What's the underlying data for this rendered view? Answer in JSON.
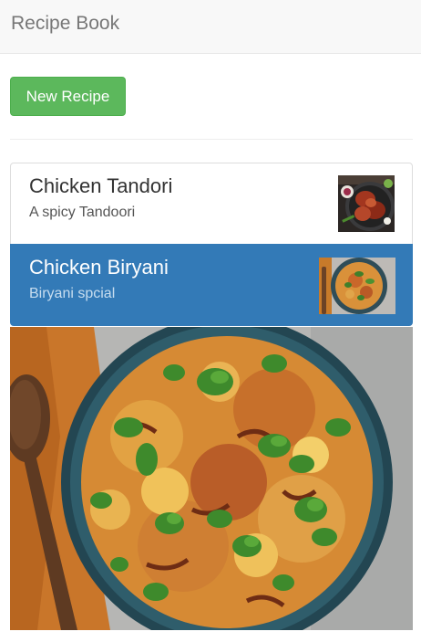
{
  "navbar": {
    "brand": "Recipe Book"
  },
  "toolbar": {
    "new_recipe_label": "New Recipe"
  },
  "recipes": [
    {
      "name": "Chicken Tandori",
      "description": "A spicy Tandoori",
      "image": "tandoori-chicken-photo",
      "active": false
    },
    {
      "name": "Chicken Biryani",
      "description": "Biryani spcial",
      "image": "biryani-bowl-photo",
      "active": true
    }
  ],
  "detail": {
    "image": "biryani-bowl-photo"
  },
  "colors": {
    "navbar_bg": "#f8f8f8",
    "success": "#5cb85c",
    "active": "#337ab7",
    "brand_text": "#777777"
  }
}
